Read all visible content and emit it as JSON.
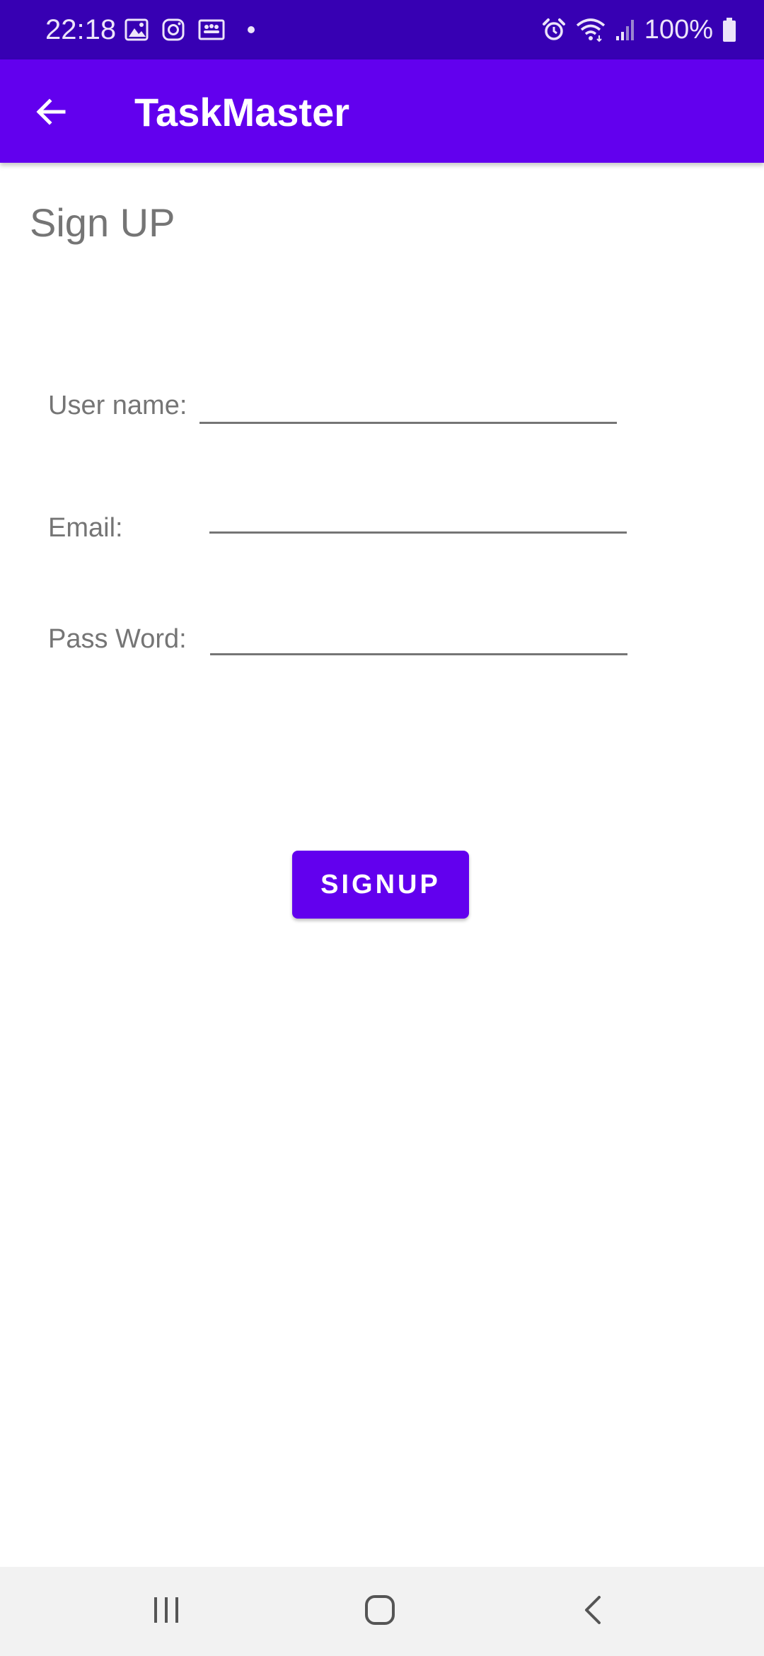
{
  "status_bar": {
    "time": "22:18",
    "left_icons": [
      "gallery-icon",
      "instagram-icon",
      "teams-icon",
      "notification-dot-icon"
    ],
    "right_icons": [
      "alarm-icon",
      "wifi-icon",
      "signal-icon",
      "battery-icon"
    ],
    "battery_text": "100%"
  },
  "app_bar": {
    "title": "TaskMaster",
    "back_icon": "arrow-back-icon"
  },
  "page": {
    "heading": "Sign UP"
  },
  "form": {
    "username_label": "User name:",
    "username_value": "",
    "email_label": "Email:",
    "email_value": "",
    "password_label": "Pass Word:",
    "password_value": "",
    "submit_label": "SIGNUP"
  },
  "nav_bar": {
    "icons": [
      "recent-apps-icon",
      "home-icon",
      "back-icon"
    ]
  },
  "colors": {
    "status_bar": "#3700b3",
    "primary": "#6200ee",
    "label_text": "#757575",
    "nav_bar": "#f2f2f2"
  }
}
